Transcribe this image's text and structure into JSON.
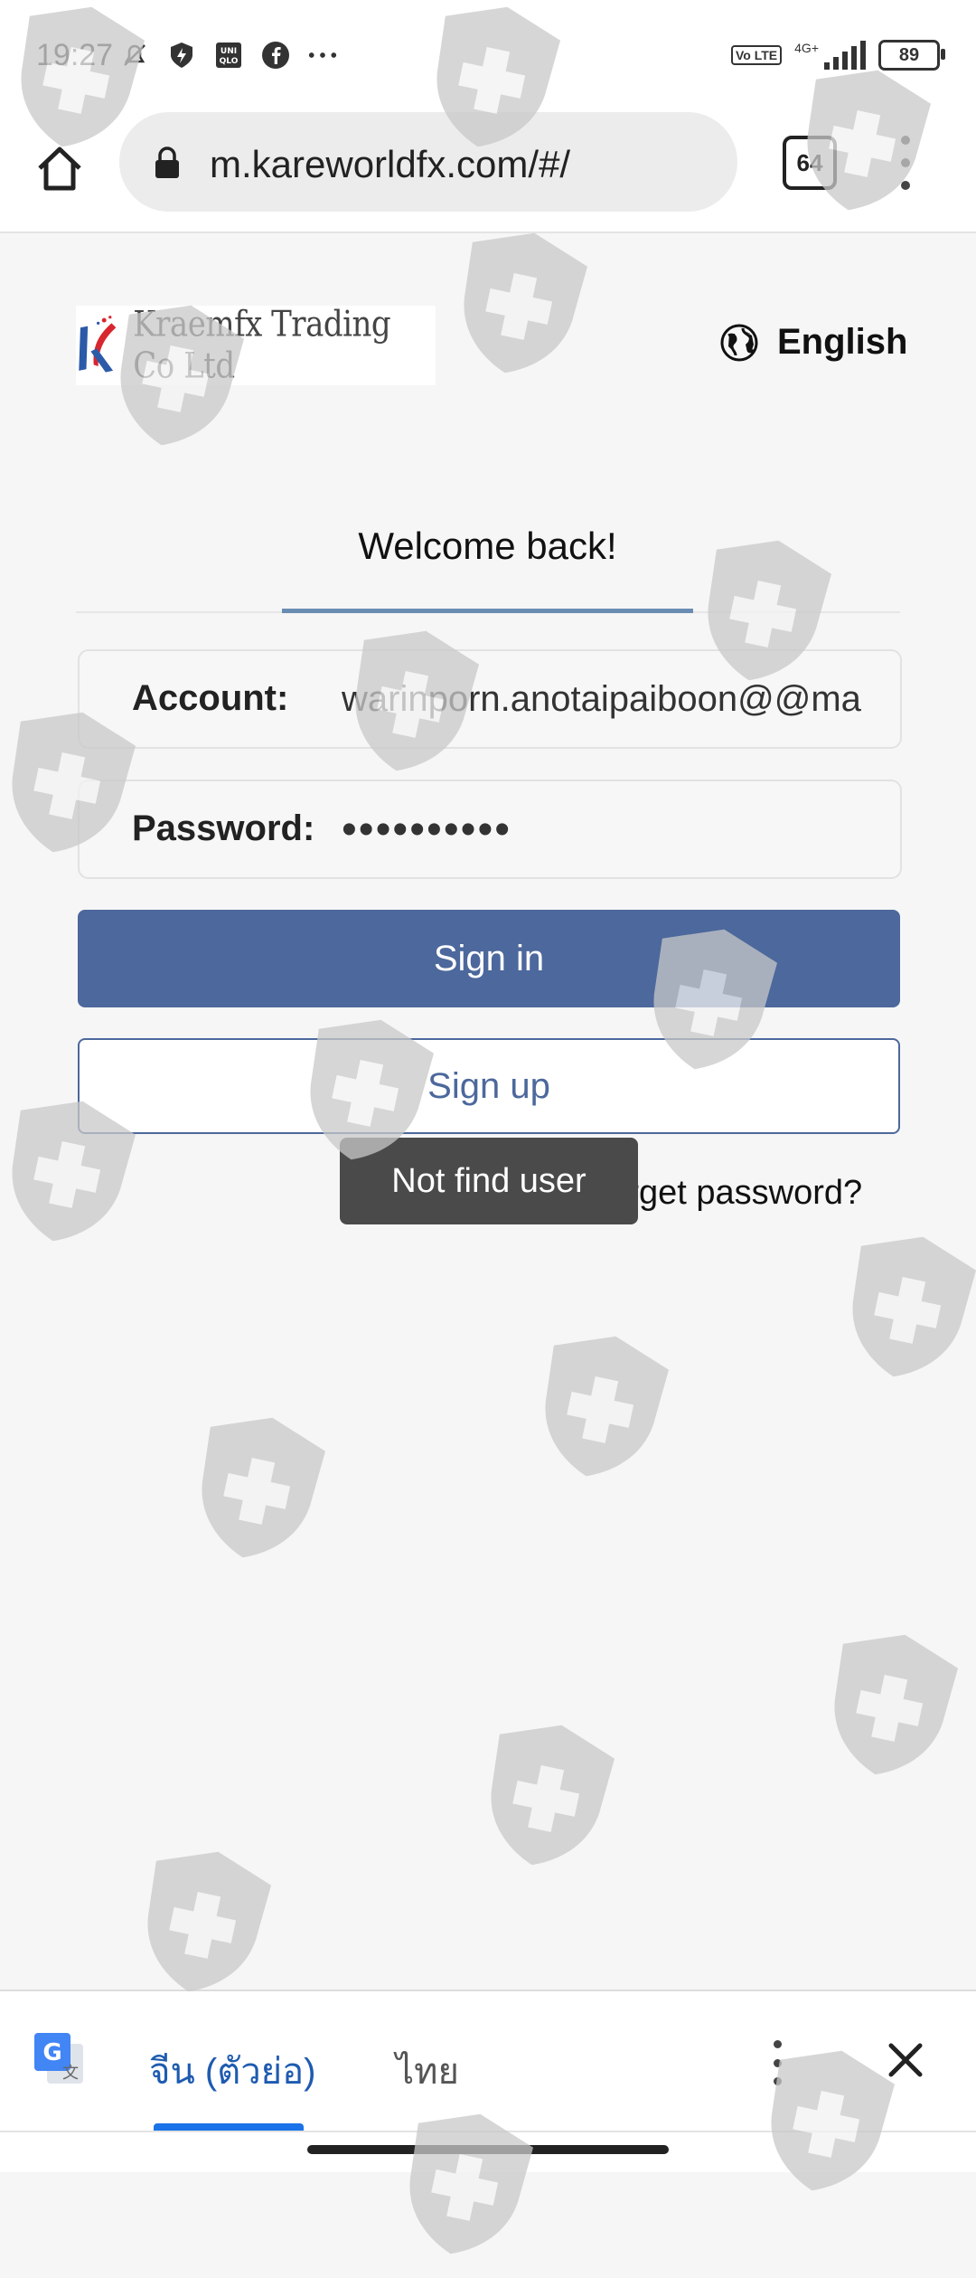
{
  "status_bar": {
    "time": "19:27",
    "network": "4G+",
    "volte": "Vo LTE",
    "battery": "89"
  },
  "browser": {
    "url": "m.kareworldfx.com/#/",
    "tab_count": "64"
  },
  "header": {
    "logo_text": "Kraemfx Trading Co Ltd",
    "language": "English"
  },
  "tabs": {
    "active": "Welcome back!"
  },
  "form": {
    "account_label": "Account:",
    "account_value": "warinporn.anotaipaiboon@@ma",
    "password_label": "Password:",
    "password_value": "••••••••••",
    "signin_label": "Sign in",
    "signup_label": "Sign up",
    "forget_label": "Forget password?"
  },
  "toast": {
    "message": "Not find user"
  },
  "translate_bar": {
    "source_lang": "จีน (ตัวย่อ)",
    "target_lang": "ไทย"
  },
  "colors": {
    "primary": "#4c689c",
    "tab_underline": "#6b8cb2",
    "translate_accent": "#1a73e8"
  }
}
